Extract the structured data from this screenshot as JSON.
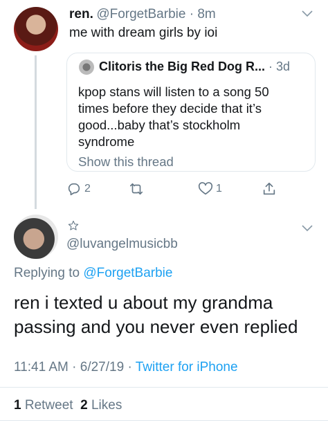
{
  "tweet1": {
    "display_name": "ren.",
    "handle": "@ForgetBarbie",
    "time": "8m",
    "text": "me with dream girls by ioi"
  },
  "quote": {
    "display_name": "Clitoris the Big Red Dog R...",
    "time": "3d",
    "text": "kpop stans will listen to a song 50 times before they decide that it’s good...baby that’s stockholm syndrome",
    "show_thread": "Show this thread"
  },
  "actions": {
    "reply_count": "2",
    "like_count": "1"
  },
  "tweet2": {
    "handle": "@luvangelmusicbb",
    "replying_prefix": "Replying to",
    "replying_to": "@ForgetBarbie",
    "text": "ren i texted u about my grandma passing and you never even replied",
    "time": "11:41 AM",
    "date": "6/27/19",
    "source": "Twitter for iPhone",
    "retweet_count": "1",
    "retweet_label": "Retweet",
    "like_count": "2",
    "like_label": "Likes"
  },
  "icons": {
    "reply": "reply-icon",
    "retweet": "retweet-icon",
    "like": "heart-icon",
    "share": "share-icon",
    "more": "chevron-down-icon",
    "star": "star-icon"
  },
  "colors": {
    "link": "#1da1f2",
    "muted": "#657786",
    "text": "#14171a",
    "border": "#e1e8ed"
  }
}
